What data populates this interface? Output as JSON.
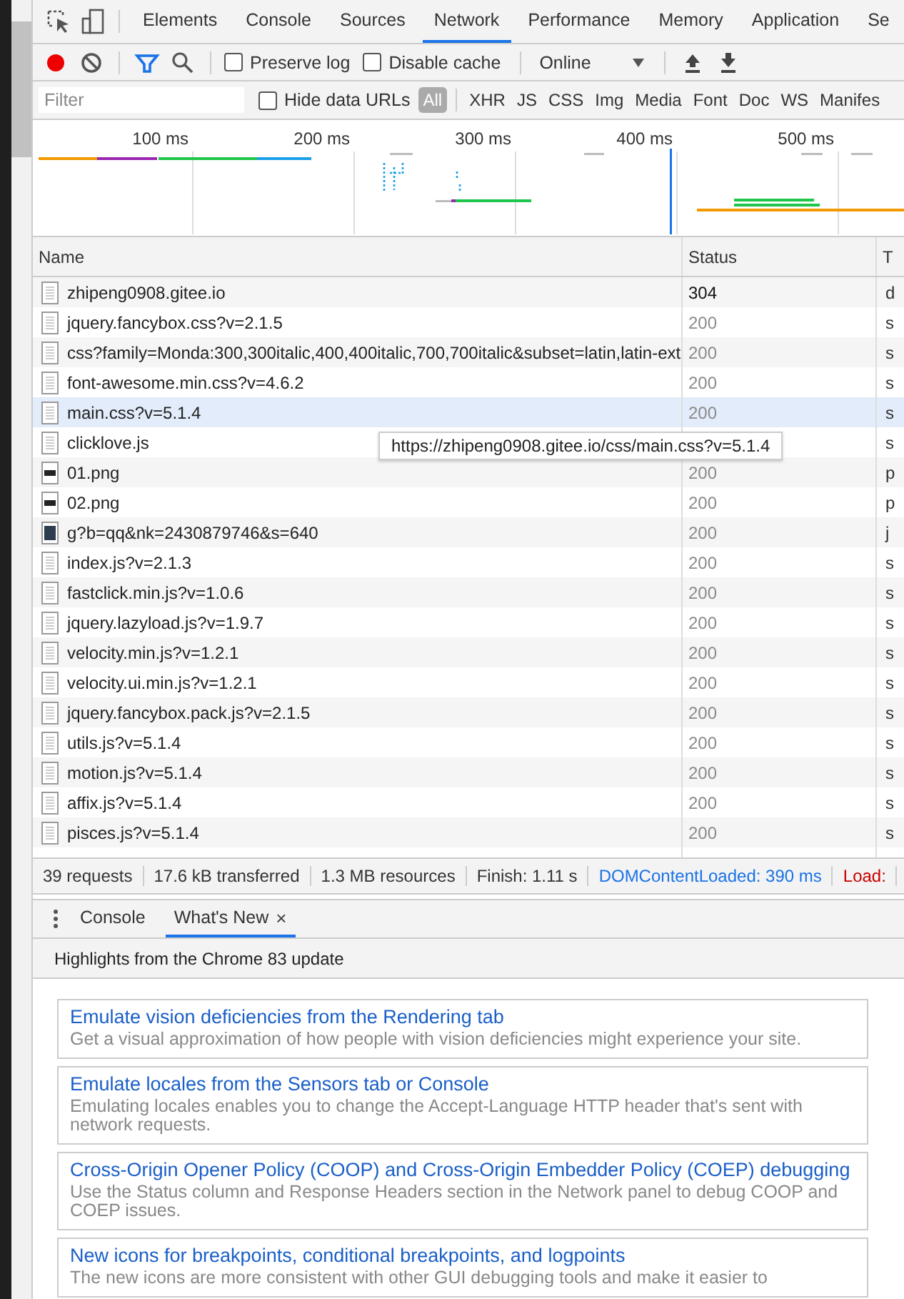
{
  "panel_tabs": [
    {
      "label": "Elements",
      "selected": false
    },
    {
      "label": "Console",
      "selected": false
    },
    {
      "label": "Sources",
      "selected": false
    },
    {
      "label": "Network",
      "selected": true
    },
    {
      "label": "Performance",
      "selected": false
    },
    {
      "label": "Memory",
      "selected": false
    },
    {
      "label": "Application",
      "selected": false
    },
    {
      "label": "Se",
      "selected": false
    }
  ],
  "toolbar": {
    "recording": true,
    "preserve_log": {
      "label": "Preserve log",
      "checked": false
    },
    "disable_cache": {
      "label": "Disable cache",
      "checked": false
    },
    "throttling": "Online"
  },
  "filter_bar": {
    "placeholder": "Filter",
    "hide_data_urls": {
      "label": "Hide data URLs",
      "checked": false
    },
    "types": [
      {
        "label": "All",
        "selected": true
      },
      {
        "label": "XHR",
        "selected": false
      },
      {
        "label": "JS",
        "selected": false
      },
      {
        "label": "CSS",
        "selected": false
      },
      {
        "label": "Img",
        "selected": false
      },
      {
        "label": "Media",
        "selected": false
      },
      {
        "label": "Font",
        "selected": false
      },
      {
        "label": "Doc",
        "selected": false
      },
      {
        "label": "WS",
        "selected": false
      },
      {
        "label": "Manifes",
        "selected": false
      }
    ]
  },
  "overview": {
    "ticks": [
      "100 ms",
      "200 ms",
      "300 ms",
      "400 ms",
      "500 ms"
    ]
  },
  "table": {
    "columns": [
      "Name",
      "Status",
      "T"
    ],
    "rows": [
      {
        "kind": "document",
        "name": "zhipeng0908.gitee.io",
        "status": "304",
        "column_3": "d",
        "dimmed": false,
        "hovered": false
      },
      {
        "kind": "document",
        "name": "jquery.fancybox.css?v=2.1.5",
        "status": "200",
        "column_3": "s",
        "dimmed": true,
        "hovered": false
      },
      {
        "kind": "document",
        "name": "css?family=Monda:300,300italic,400,400italic,700,700italic&subset=latin,latin-ext",
        "status": "200",
        "column_3": "s",
        "dimmed": true,
        "hovered": false
      },
      {
        "kind": "document",
        "name": "font-awesome.min.css?v=4.6.2",
        "status": "200",
        "column_3": "s",
        "dimmed": true,
        "hovered": false
      },
      {
        "kind": "document",
        "name": "main.css?v=5.1.4",
        "status": "200",
        "column_3": "s",
        "dimmed": true,
        "hovered": true
      },
      {
        "kind": "document",
        "name": "clicklove.js",
        "column_3": "s",
        "hovered": false
      },
      {
        "kind": "image",
        "name": "01.png",
        "status": "200",
        "column_3": "p",
        "dimmed": true,
        "hovered": false
      },
      {
        "kind": "image",
        "name": "02.png",
        "status": "200",
        "column_3": "p",
        "dimmed": true,
        "hovered": false
      },
      {
        "kind": "photo",
        "name": "g?b=qq&nk=2430879746&s=640",
        "status": "200",
        "column_3": "j",
        "dimmed": true,
        "hovered": false
      },
      {
        "kind": "document",
        "name": "index.js?v=2.1.3",
        "status": "200",
        "column_3": "s",
        "dimmed": true,
        "hovered": false
      },
      {
        "kind": "document",
        "name": "fastclick.min.js?v=1.0.6",
        "status": "200",
        "column_3": "s",
        "dimmed": true,
        "hovered": false
      },
      {
        "kind": "document",
        "name": "jquery.lazyload.js?v=1.9.7",
        "status": "200",
        "column_3": "s",
        "dimmed": true,
        "hovered": false
      },
      {
        "kind": "document",
        "name": "velocity.min.js?v=1.2.1",
        "status": "200",
        "column_3": "s",
        "dimmed": true,
        "hovered": false
      },
      {
        "kind": "document",
        "name": "velocity.ui.min.js?v=1.2.1",
        "status": "200",
        "column_3": "s",
        "dimmed": true,
        "hovered": false
      },
      {
        "kind": "document",
        "name": "jquery.fancybox.pack.js?v=2.1.5",
        "status": "200",
        "column_3": "s",
        "dimmed": true,
        "hovered": false
      },
      {
        "kind": "document",
        "name": "utils.js?v=5.1.4",
        "status": "200",
        "column_3": "s",
        "dimmed": true,
        "hovered": false
      },
      {
        "kind": "document",
        "name": "motion.js?v=5.1.4",
        "status": "200",
        "column_3": "s",
        "dimmed": true,
        "hovered": false
      },
      {
        "kind": "document",
        "name": "affix.js?v=5.1.4",
        "status": "200",
        "column_3": "s",
        "dimmed": true,
        "hovered": false
      },
      {
        "kind": "document",
        "name": "pisces.js?v=5.1.4",
        "status": "200",
        "column_3": "s",
        "dimmed": true,
        "hovered": false
      }
    ]
  },
  "tooltip": "https://zhipeng0908.gitee.io/css/main.css?v=5.1.4",
  "status_bar": [
    {
      "text": "39 requests",
      "kind": "plain"
    },
    {
      "text": "17.6 kB transferred",
      "kind": "plain"
    },
    {
      "text": "1.3 MB resources",
      "kind": "plain"
    },
    {
      "text": "Finish: 1.11 s",
      "kind": "plain"
    },
    {
      "text": "DOMContentLoaded: 390 ms",
      "kind": "dom"
    },
    {
      "text": "Load:",
      "kind": "load"
    }
  ],
  "drawer_tabs": [
    {
      "label": "Console",
      "selected": false,
      "closable": false
    },
    {
      "label": "What's New",
      "selected": true,
      "closable": true,
      "close": "×"
    }
  ],
  "whats_new": {
    "heading": "Highlights from the Chrome 83 update",
    "items": [
      {
        "title": "Emulate vision deficiencies from the Rendering tab",
        "text": "Get a visual approximation of how people with vision deficiencies might experience your site."
      },
      {
        "title": "Emulate locales from the Sensors tab or Console",
        "text": "Emulating locales enables you to change the Accept-Language HTTP header that's sent with network requests."
      },
      {
        "title": "Cross-Origin Opener Policy (COOP) and Cross-Origin Embedder Policy (COEP) debugging",
        "text": "Use the Status column and Response Headers section in the Network panel to debug COOP and COEP issues."
      },
      {
        "title": "New icons for breakpoints, conditional breakpoints, and logpoints",
        "text": "The new icons are more consistent with other GUI debugging tools and make it easier to"
      }
    ]
  }
}
